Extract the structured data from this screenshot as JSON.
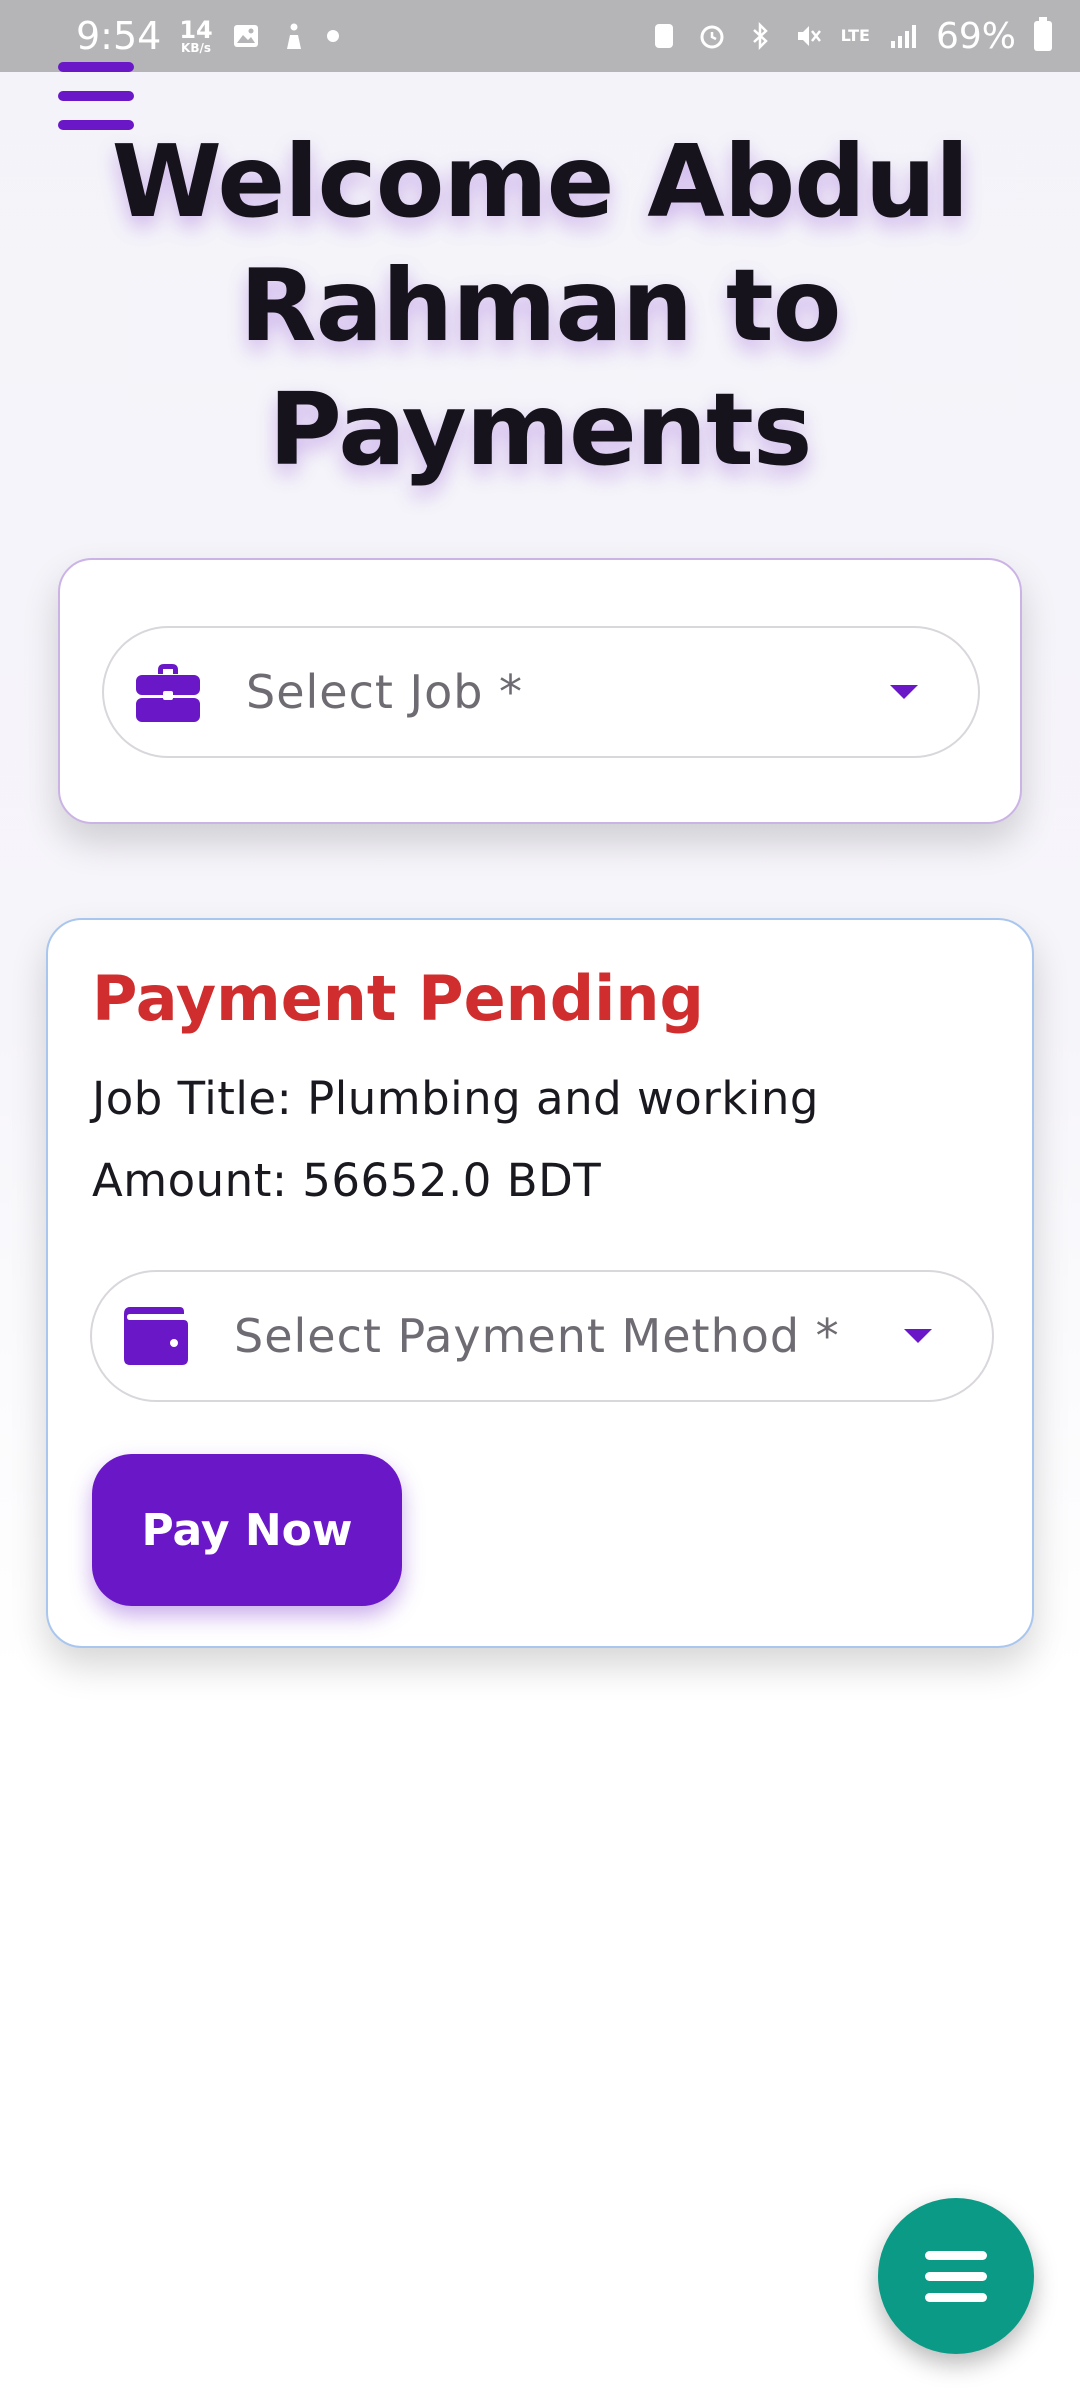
{
  "status_bar": {
    "time": "9:54",
    "data_speed": "14",
    "data_unit": "KB/s",
    "network": "LTE",
    "battery": "69%"
  },
  "header": {
    "title": "Welcome Abdul Rahman to Payments"
  },
  "job_select": {
    "label": "Select Job *",
    "icon": "briefcase-icon"
  },
  "payment": {
    "status": "Payment Pending",
    "job_title": "Job Title: Plumbing and working",
    "amount": "Amount: 56652.0 BDT",
    "method_label": "Select Payment Method *",
    "method_icon": "wallet-icon",
    "pay_button": "Pay Now"
  },
  "colors": {
    "accent": "#6a17c8",
    "pending": "#d02e2e",
    "fab": "#0b9a86"
  }
}
